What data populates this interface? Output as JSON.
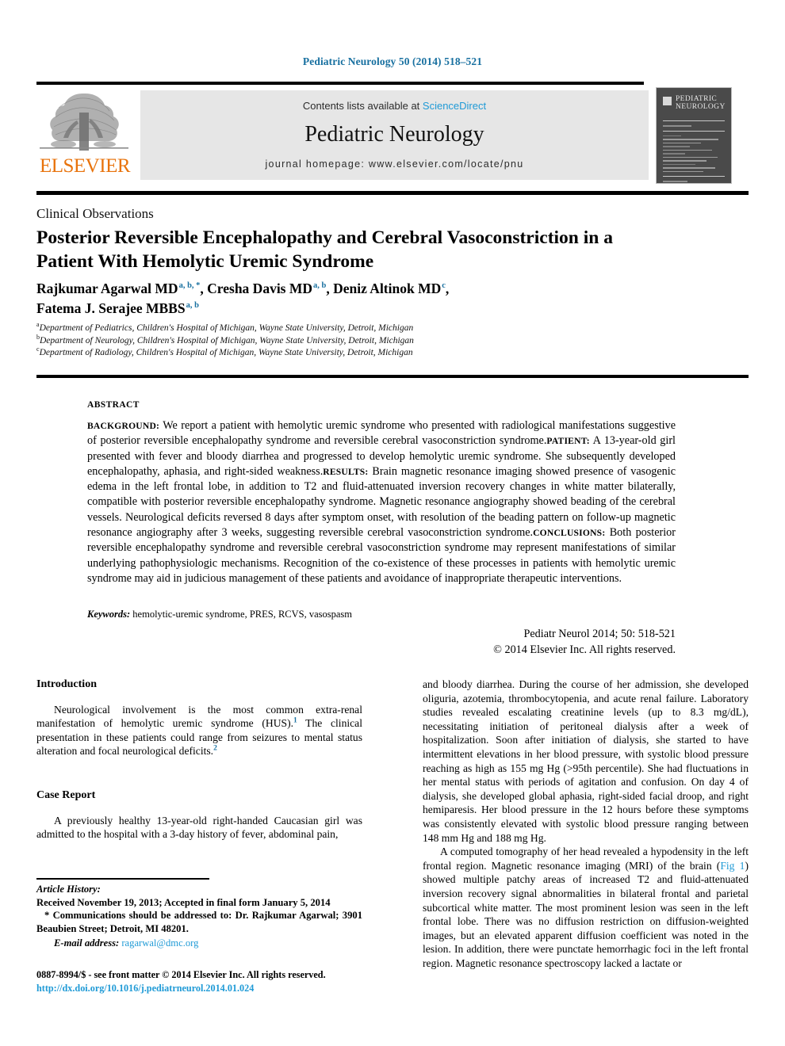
{
  "running_head": "Pediatric Neurology 50 (2014) 518–521",
  "masthead": {
    "publisher_name": "ELSEVIER",
    "contents_prefix": "Contents lists available at ",
    "contents_link": "ScienceDirect",
    "journal_title": "Pediatric Neurology",
    "journal_homepage": "journal homepage: www.elsevier.com/locate/pnu",
    "cover_title": "PEDIATRIC NEUROLOGY"
  },
  "article": {
    "type": "Clinical Observations",
    "title": "Posterior Reversible Encephalopathy and Cerebral Vasoconstriction in a Patient With Hemolytic Uremic Syndrome",
    "authors_line_1_a": "Rajkumar Agarwal MD",
    "authors_line_1_a_sup": "a, b, *",
    "authors_line_1_b": ", Cresha Davis MD",
    "authors_line_1_b_sup": "a, b",
    "authors_line_1_c": ", Deniz Altinok MD",
    "authors_line_1_c_sup": "c",
    "authors_line_1_end": ",",
    "authors_line_2": "Fatema J. Serajee MBBS",
    "authors_line_2_sup": "a, b",
    "affiliations": [
      {
        "marker": "a",
        "text": "Department of Pediatrics, Children's Hospital of Michigan, Wayne State University, Detroit, Michigan"
      },
      {
        "marker": "b",
        "text": "Department of Neurology, Children's Hospital of Michigan, Wayne State University, Detroit, Michigan"
      },
      {
        "marker": "c",
        "text": "Department of Radiology, Children's Hospital of Michigan, Wayne State University, Detroit, Michigan"
      }
    ]
  },
  "abstract": {
    "label": "ABSTRACT",
    "sections": [
      {
        "head": "BACKGROUND:",
        "text": " We report a patient with hemolytic uremic syndrome who presented with radiological manifestations suggestive of posterior reversible encephalopathy syndrome and reversible cerebral vasoconstriction syndrome."
      },
      {
        "head": "PATIENT:",
        "text": " A 13-year-old girl presented with fever and bloody diarrhea and progressed to develop hemolytic uremic syndrome. She subsequently developed encephalopathy, aphasia, and right-sided weakness."
      },
      {
        "head": "RESULTS:",
        "text": " Brain magnetic resonance imaging showed presence of vasogenic edema in the left frontal lobe, in addition to T2 and fluid-attenuated inversion recovery changes in white matter bilaterally, compatible with posterior reversible encephalopathy syndrome. Magnetic resonance angiography showed beading of the cerebral vessels. Neurological deficits reversed 8 days after symptom onset, with resolution of the beading pattern on follow-up magnetic resonance angiography after 3 weeks, suggesting reversible cerebral vasoconstriction syndrome."
      },
      {
        "head": "CONCLUSIONS:",
        "text": " Both posterior reversible encephalopathy syndrome and reversible cerebral vasoconstriction syndrome may represent manifestations of similar underlying pathophysiologic mechanisms. Recognition of the co-existence of these processes in patients with hemolytic uremic syndrome may aid in judicious management of these patients and avoidance of inappropriate therapeutic interventions."
      }
    ],
    "keywords_label": "Keywords:",
    "keywords_value": " hemolytic-uremic syndrome, PRES, RCVS, vasospasm",
    "citation": "Pediatr Neurol 2014; 50: 518-521",
    "copyright": "© 2014 Elsevier Inc. All rights reserved."
  },
  "body": {
    "left": {
      "intro_head": "Introduction",
      "intro_p1_a": "Neurological involvement is the most common extra-renal manifestation of hemolytic uremic syndrome (HUS).",
      "intro_p1_ref1": "1",
      "intro_p1_b": " The clinical presentation in these patients could range from seizures to mental status alteration and focal neurological deficits.",
      "intro_p1_ref2": "2",
      "case_head": "Case Report",
      "case_p1": "A previously healthy 13-year-old right-handed Caucasian girl was admitted to the hospital with a 3-day history of fever, abdominal pain,"
    },
    "right": {
      "p1": "and bloody diarrhea. During the course of her admission, she developed oliguria, azotemia, thrombocytopenia, and acute renal failure. Laboratory studies revealed escalating creatinine levels (up to 8.3 mg/dL), necessitating initiation of peritoneal dialysis after a week of hospitalization. Soon after initiation of dialysis, she started to have intermittent elevations in her blood pressure, with systolic blood pressure reaching as high as 155 mg Hg (>95th percentile). She had fluctuations in her mental status with periods of agitation and confusion. On day 4 of dialysis, she developed global aphasia, right-sided facial droop, and right hemiparesis. Her blood pressure in the 12 hours before these symptoms was consistently elevated with systolic blood pressure ranging between 148 mm Hg and 188 mg Hg.",
      "p2_a": "A computed tomography of her head revealed a hypodensity in the left frontal region. Magnetic resonance imaging (MRI) of the brain (",
      "p2_figlink": "Fig 1",
      "p2_b": ") showed multiple patchy areas of increased T2 and fluid-attenuated inversion recovery signal abnormalities in bilateral frontal and parietal subcortical white matter. The most prominent lesion was seen in the left frontal lobe. There was no diffusion restriction on diffusion-weighted images, but an elevated apparent diffusion coefficient was noted in the lesion. In addition, there were punctate hemorrhagic foci in the left frontal region. Magnetic resonance spectroscopy lacked a lactate or"
    }
  },
  "footer": {
    "history_label": "Article History:",
    "history_value": "Received November 19, 2013; Accepted in final form January 5, 2014",
    "correspondence": "* Communications should be addressed to: Dr. Rajkumar Agarwal; 3901 Beaubien Street; Detroit, MI 48201.",
    "email_label": "E-mail address:",
    "email_value": " ragarwal@dmc.org",
    "issn_line": "0887-8994/$ - see front matter © 2014 Elsevier Inc. All rights reserved.",
    "doi_line": "http://dx.doi.org/10.1016/j.pediatrneurol.2014.01.024"
  },
  "colors": {
    "link_blue": "#1f9ad6",
    "header_blue": "#1870a0",
    "elsevier_orange": "#E8730C",
    "journal_box_gray": "#e6e6e6"
  }
}
